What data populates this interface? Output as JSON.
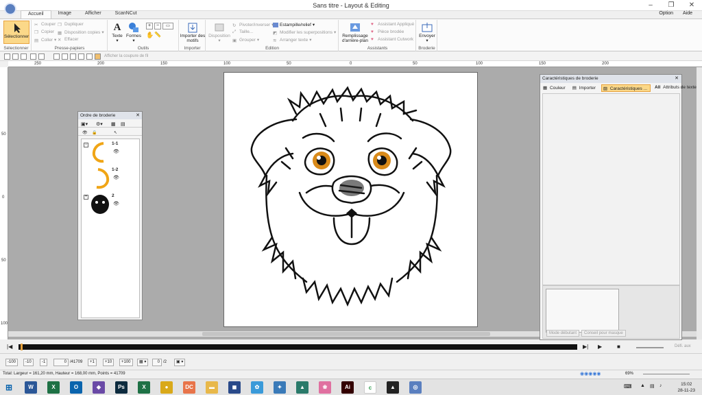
{
  "window": {
    "title": "Sans titre - Layout & Editing"
  },
  "tabs": [
    {
      "label": "Accueil"
    },
    {
      "label": "Image"
    },
    {
      "label": "Afficher"
    },
    {
      "label": "ScanNCut"
    }
  ],
  "top_right": {
    "option": "Option",
    "help": "Aide"
  },
  "ribbon": {
    "select_group": {
      "button": "Sélectionner",
      "name": "Sélectionner"
    },
    "clipboard": {
      "name": "Presse-papiers",
      "cut": "Couper",
      "copy": "Copier",
      "paste": "Coller",
      "duplicate": "Dupliquer",
      "copy_layout": "Disposition copies",
      "delete": "Effacer"
    },
    "tools": {
      "name": "Outils",
      "text": "Texte",
      "shapes": "Formes"
    },
    "import": {
      "name": "Importer",
      "button": "Importer des motifs"
    },
    "edit": {
      "name": "Edition",
      "layout": "Disposition",
      "rotate_invert": "Pivoter/inverser",
      "size": "Taille...",
      "group": "Grouper",
      "stamp": "Estampille/relief",
      "modify_overlaps": "Modifier les superpositions",
      "arrange_text": "Arranger texte",
      "fill_bg": "Remplissage d'arrière-plan"
    },
    "assistants": {
      "name": "Assistants",
      "applique": "Assistant Appliqué",
      "piece": "Pièce brodée",
      "cutwork": "Assistant Cutwork"
    },
    "embroidery": {
      "name": "Broderie",
      "send": "Envoyer"
    }
  },
  "quick_toolbar": {
    "show_cut_line": "Afficher la coupure de fil"
  },
  "ruler": {
    "top_labels": [
      "250",
      "200",
      "150",
      "100",
      "50",
      "0",
      "50",
      "100",
      "150",
      "200"
    ],
    "left_labels": [
      "50",
      "0",
      "50",
      "100"
    ]
  },
  "order_panel": {
    "title": "Ordre de broderie",
    "items": [
      {
        "label": "1-1",
        "color": "#f0a516"
      },
      {
        "label": "1-2",
        "color": "#f0a516"
      },
      {
        "label": "2",
        "color": "#111111"
      }
    ]
  },
  "char_panel": {
    "title": "Caractéristiques de broderie",
    "tabs": [
      {
        "label": "Couleur"
      },
      {
        "label": "Importer"
      },
      {
        "label": "Caractéristiques ..."
      },
      {
        "label": "Attributs de texte"
      }
    ],
    "beginner_mode": "Mode débutant",
    "mask_advice": "Conseil pour masque"
  },
  "timeline": {
    "current": "0",
    "total": "/41709",
    "page_current": "0",
    "page_total": "/2"
  },
  "step_buttons": [
    "-100",
    "-10",
    "-1",
    "+1",
    "+10",
    "+100"
  ],
  "play_label": "Défi. aux",
  "statusbar": {
    "text": "Total: Largeur = 161,20 mm, Hauteur = 168,00 mm, Points = 41709",
    "zoom": "69%"
  },
  "taskbar": {
    "time": "15:02",
    "date": "28-11-23",
    "apps": [
      {
        "name": "word-icon",
        "color": "#2b5797",
        "glyph": "W"
      },
      {
        "name": "excel-icon",
        "color": "#1e7145",
        "glyph": "X"
      },
      {
        "name": "outlook-icon",
        "color": "#0a64ad",
        "glyph": "O"
      },
      {
        "name": "app-icon",
        "color": "#6a4aa6",
        "glyph": "◆"
      },
      {
        "name": "photoshop-icon",
        "color": "#0d2b3e",
        "glyph": "Ps"
      },
      {
        "name": "excel2-icon",
        "color": "#1e7145",
        "glyph": "X"
      },
      {
        "name": "chrome-icon",
        "color": "#d9a91a",
        "glyph": "●"
      },
      {
        "name": "dc-icon",
        "color": "#e8744a",
        "glyph": "DC"
      },
      {
        "name": "folder-icon",
        "color": "#e8b84a",
        "glyph": "▬"
      },
      {
        "name": "app2-icon",
        "color": "#2a4a8a",
        "glyph": "◼"
      },
      {
        "name": "app3-icon",
        "color": "#3a9ad9",
        "glyph": "✿"
      },
      {
        "name": "app4-icon",
        "color": "#3a7ab8",
        "glyph": "✦"
      },
      {
        "name": "app5-icon",
        "color": "#2a7a6a",
        "glyph": "▲"
      },
      {
        "name": "flower-icon",
        "color": "#e070a0",
        "glyph": "❀"
      },
      {
        "name": "illustrator-icon",
        "color": "#330000",
        "glyph": "Ai"
      },
      {
        "name": "cricut-icon",
        "color": "#ffffff",
        "glyph": "c"
      },
      {
        "name": "inkscape-icon",
        "color": "#222222",
        "glyph": "▲"
      },
      {
        "name": "pe-design-icon",
        "color": "#5a7fbf",
        "glyph": "◎"
      }
    ]
  }
}
